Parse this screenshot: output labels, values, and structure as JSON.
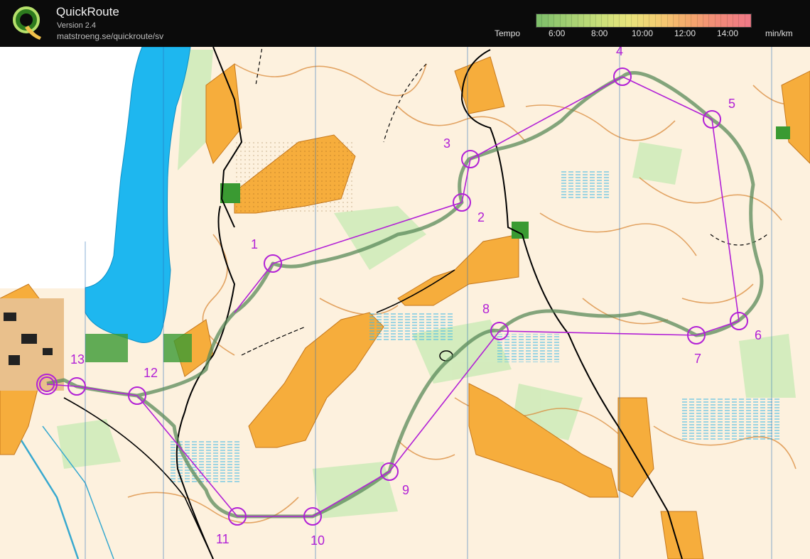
{
  "header": {
    "title": "QuickRoute",
    "version": "Version 2.4",
    "url": "matstroeng.se/quickroute/sv",
    "logo_icon": "quickroute-logo-icon"
  },
  "tempo_legend": {
    "label": "Tempo",
    "ticks": [
      "6:00",
      "8:00",
      "10:00",
      "12:00",
      "14:00"
    ],
    "unit": "min/km",
    "gradient_colors": [
      "#7fbf6a",
      "#a3cf73",
      "#c8df7a",
      "#e8e47c",
      "#f4cd72",
      "#f4a96c",
      "#f28a78",
      "#ef7a86"
    ]
  },
  "map": {
    "course_color": "#b220d6",
    "route_color": "#5a8a5a",
    "controls": [
      {
        "number": "1"
      },
      {
        "number": "2"
      },
      {
        "number": "3"
      },
      {
        "number": "4"
      },
      {
        "number": "5"
      },
      {
        "number": "6"
      },
      {
        "number": "7"
      },
      {
        "number": "8"
      },
      {
        "number": "9"
      },
      {
        "number": "10"
      },
      {
        "number": "11"
      },
      {
        "number": "12"
      },
      {
        "number": "13"
      }
    ]
  }
}
